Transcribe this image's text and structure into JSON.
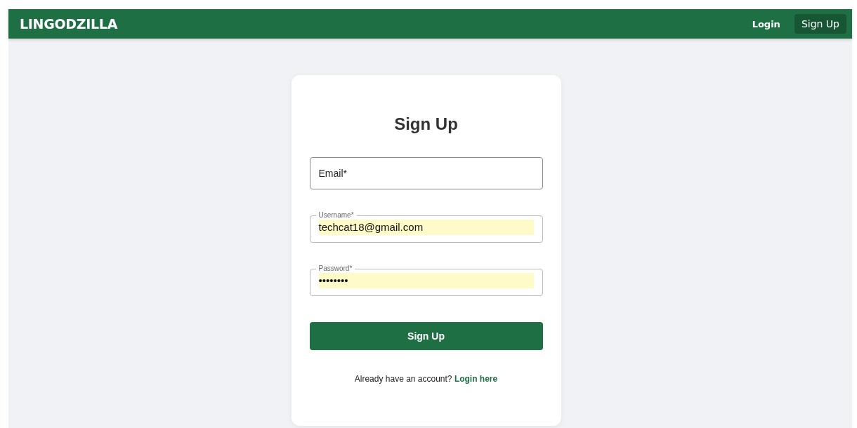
{
  "navbar": {
    "brand": "LINGODZILLA",
    "links": [
      {
        "label": "Login",
        "selected": false
      },
      {
        "label": "Sign Up",
        "selected": true
      }
    ]
  },
  "form": {
    "title": "Sign Up",
    "fields": [
      {
        "label": "Email*"
      },
      {
        "label": "Username*",
        "value": "techcat18@gmail.com",
        "autofilled": true
      },
      {
        "label": "Password*",
        "value": "••••••••",
        "autofilled": true
      }
    ],
    "submit": "Sign Up",
    "footer": {
      "text": "Already have an account?",
      "link": "Login here"
    }
  }
}
